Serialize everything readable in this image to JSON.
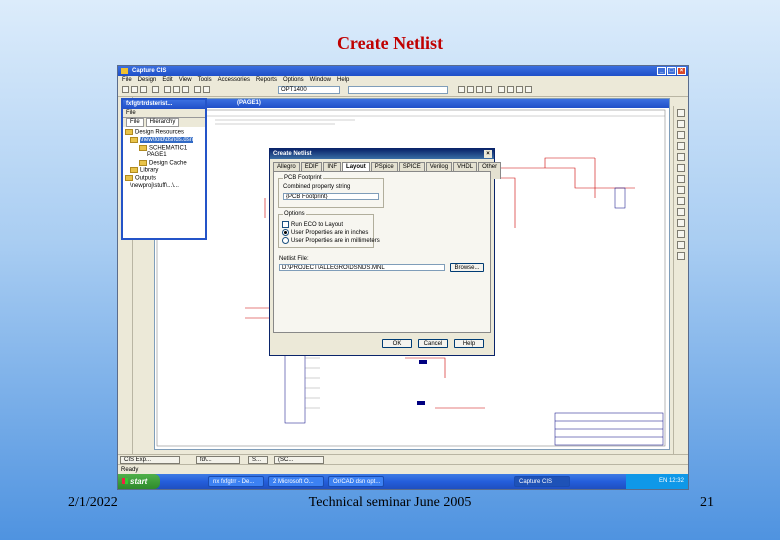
{
  "slide": {
    "title": "Create Netlist",
    "date": "2/1/2022",
    "footer_center": "Technical seminar June 2005",
    "page_number": "21"
  },
  "app": {
    "title": "Capture CIS",
    "menu": [
      "File",
      "Design",
      "Edit",
      "View",
      "Tools",
      "Accessories",
      "Reports",
      "Options",
      "Window",
      "Help"
    ],
    "toolbar_combo": "OPT1400"
  },
  "project": {
    "title": "fxfgtrtrdsterist...",
    "tab": "File",
    "tab2": "Hierarchy",
    "tree": [
      "Design Resources",
      "\\new\\fold\\dsnds.dsn",
      "SCHEMATIC1",
      "PAGE1",
      "Design Cache",
      "Library",
      "Outputs",
      "\\newproj\\stuff\\...\\..."
    ]
  },
  "schematic": {
    "title": "(PAGE1)"
  },
  "dialog": {
    "title": "Create Netlist",
    "tabs": [
      "Allegro",
      "EDIF 2 0 0",
      "INF",
      "Layout",
      "PSpice",
      "SPICE",
      "Verilog",
      "VHDL",
      "Other"
    ],
    "active_tab": "Layout",
    "pcb_footprint_group": "PCB Footprint",
    "combined_label": "Combined property string",
    "combined_value": "{PCB Footprint}",
    "options_group": "Options",
    "opt1": "Run ECO to Layout",
    "opt2": "User Properties are in inches",
    "opt3": "User Properties are in millimeters",
    "netlist_file_label": "Netlist File:",
    "netlist_file_value": "D:\\PROJECT\\ALLEGRO\\DSNDS.MNL",
    "browse_label": "Browse...",
    "ok_label": "OK",
    "cancel_label": "Cancel",
    "help_label": "Help"
  },
  "inner_taskbar": [
    "CIS Exp...",
    "fd\\...",
    "S...",
    "(SC..."
  ],
  "status_text": "Ready",
  "taskbar": {
    "start": "start",
    "items": [
      "nx fxfgtrr - De...",
      "2 Microsoft O...",
      "Or/CAD dsn opt...",
      "Capture CIS"
    ],
    "active_index": 3,
    "tray": "EN  12:32"
  }
}
